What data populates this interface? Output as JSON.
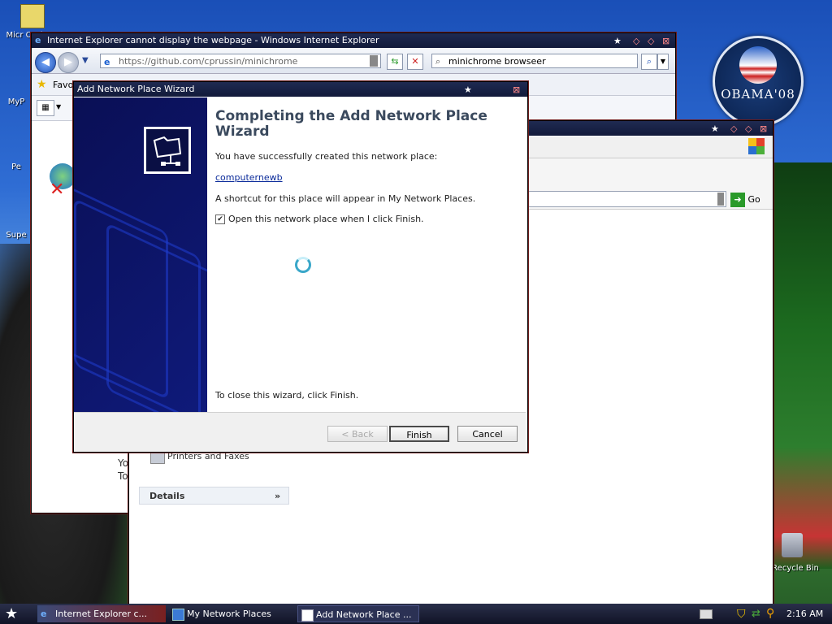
{
  "desktop": {
    "icons": [
      {
        "label": "Micr Outl"
      },
      {
        "label": "MyP"
      },
      {
        "label": "Pe"
      },
      {
        "label": "Supe"
      },
      {
        "label": "Recycle Bin"
      }
    ],
    "badge_text": "OBAMA'08"
  },
  "ie_window": {
    "title": "Internet Explorer cannot display the webpage - Windows Internet Explorer",
    "address": "https://github.com/cprussin/minichrome",
    "search": "minichrome browseer",
    "favorites": "Favor",
    "body_text_1": "Yo",
    "body_text_2": "To"
  },
  "mnp_window": {
    "go_label": "Go",
    "task_printers": "Printers and Faxes",
    "details_label": "Details"
  },
  "wizard": {
    "title": "Add Network Place Wizard",
    "heading": "Completing the Add Network Place Wizard",
    "success_text": "You have successfully created this network place:",
    "place_name": "computernewb",
    "shortcut_text": "A shortcut for this place will appear in My Network Places.",
    "checkbox_label": "Open this network place when I click Finish.",
    "checkbox_checked": true,
    "close_text": "To close this wizard, click Finish.",
    "buttons": {
      "back": "< Back",
      "finish": "Finish",
      "cancel": "Cancel"
    }
  },
  "taskbar": {
    "items": [
      {
        "label": "Internet Explorer c..."
      },
      {
        "label": "My Network Places"
      },
      {
        "label": "Add Network Place ..."
      }
    ],
    "clock": "2:16 AM"
  }
}
